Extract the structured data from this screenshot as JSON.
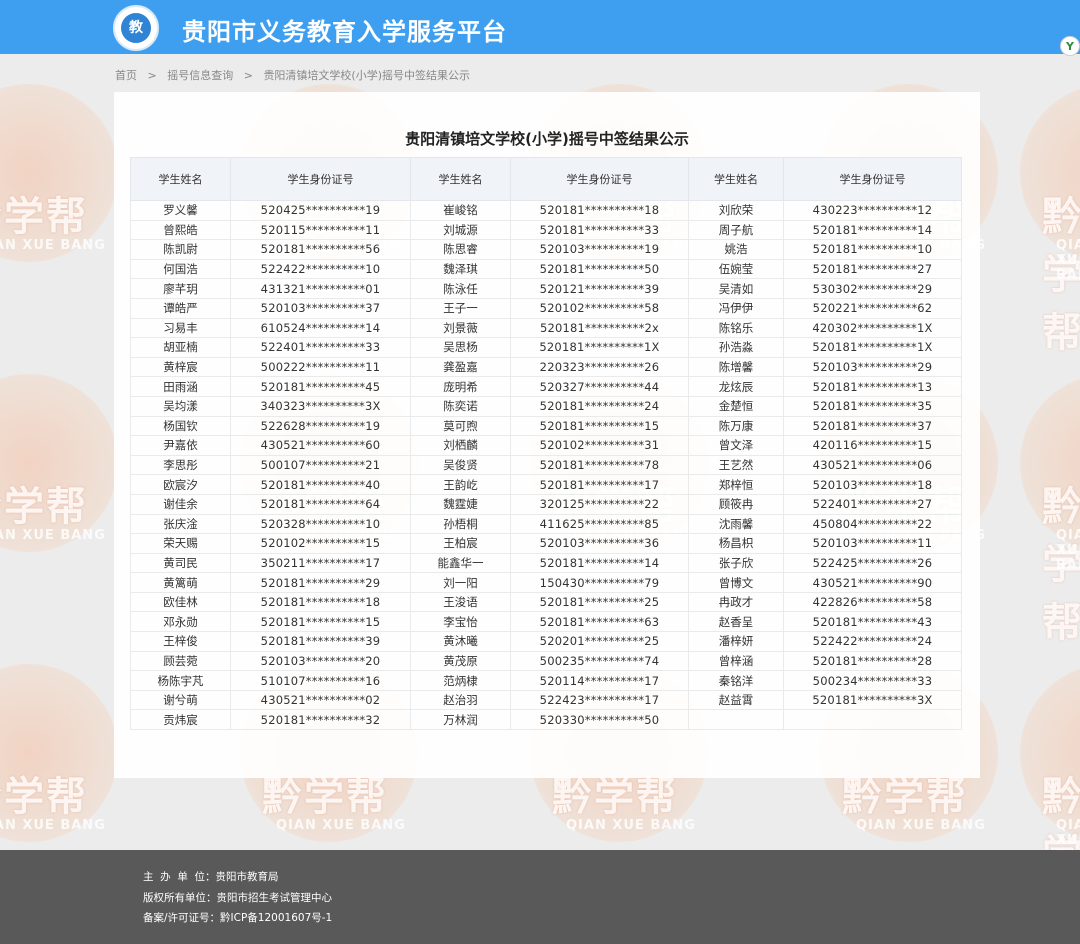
{
  "header": {
    "logo_text": "教",
    "site_title": "贵阳市义务教育入学服务平台",
    "corner_badge": "Y"
  },
  "breadcrumb": {
    "items": [
      "首页",
      "摇号信息查询",
      "贵阳清镇培文学校(小学)摇号中签结果公示"
    ],
    "separator": ">"
  },
  "watermark": {
    "brand_cn": "黔学帮",
    "brand_en": "QIAN XUE BANG"
  },
  "result_table": {
    "title": "贵阳清镇培文学校(小学)摇号中签结果公示",
    "headers": {
      "name": "学生姓名",
      "id": "学生身份证号"
    },
    "columns": [
      [
        {
          "name": "罗义馨",
          "id": "520425**********19"
        },
        {
          "name": "曾熙皓",
          "id": "520115**********11"
        },
        {
          "name": "陈凯尉",
          "id": "520181**********56"
        },
        {
          "name": "何国浩",
          "id": "522422**********10"
        },
        {
          "name": "廖芊玥",
          "id": "431321**********01"
        },
        {
          "name": "谭皓严",
          "id": "520103**********37"
        },
        {
          "name": "习易丰",
          "id": "610524**********14"
        },
        {
          "name": "胡亚楠",
          "id": "522401**********33"
        },
        {
          "name": "黄梓宸",
          "id": "500222**********11"
        },
        {
          "name": "田雨涵",
          "id": "520181**********45"
        },
        {
          "name": "吴均漾",
          "id": "340323**********3X"
        },
        {
          "name": "杨国钦",
          "id": "522628**********19"
        },
        {
          "name": "尹嘉依",
          "id": "430521**********60"
        },
        {
          "name": "李思彤",
          "id": "500107**********21"
        },
        {
          "name": "欧宸汐",
          "id": "520181**********40"
        },
        {
          "name": "谢佳余",
          "id": "520181**********64"
        },
        {
          "name": "张庆淦",
          "id": "520328**********10"
        },
        {
          "name": "荣天赐",
          "id": "520102**********15"
        },
        {
          "name": "黄司民",
          "id": "350211**********17"
        },
        {
          "name": "黄篱萌",
          "id": "520181**********29"
        },
        {
          "name": "欧佳林",
          "id": "520181**********18"
        },
        {
          "name": "邓永勋",
          "id": "520181**********15"
        },
        {
          "name": "王梓俊",
          "id": "520181**********39"
        },
        {
          "name": "顾芸菀",
          "id": "520103**********20"
        },
        {
          "name": "杨陈宇芃",
          "id": "510107**********16"
        },
        {
          "name": "谢兮萌",
          "id": "430521**********02"
        },
        {
          "name": "贡炜宸",
          "id": "520181**********32"
        }
      ],
      [
        {
          "name": "崔峻铭",
          "id": "520181**********18"
        },
        {
          "name": "刘城源",
          "id": "520181**********33"
        },
        {
          "name": "陈思睿",
          "id": "520103**********19"
        },
        {
          "name": "魏泽琪",
          "id": "520181**********50"
        },
        {
          "name": "陈泳任",
          "id": "520121**********39"
        },
        {
          "name": "王子一",
          "id": "520102**********58"
        },
        {
          "name": "刘景薇",
          "id": "520181**********2x"
        },
        {
          "name": "吴思杨",
          "id": "520181**********1X"
        },
        {
          "name": "龚盈嘉",
          "id": "220323**********26"
        },
        {
          "name": "庞明希",
          "id": "520327**********44"
        },
        {
          "name": "陈奕诺",
          "id": "520181**********24"
        },
        {
          "name": "莫可煦",
          "id": "520181**********15"
        },
        {
          "name": "刘栖麟",
          "id": "520102**********31"
        },
        {
          "name": "吴俊贤",
          "id": "520181**********78"
        },
        {
          "name": "王韵屹",
          "id": "520181**********17"
        },
        {
          "name": "魏霆婕",
          "id": "320125**********22"
        },
        {
          "name": "孙梧桐",
          "id": "411625**********85"
        },
        {
          "name": "王柏宸",
          "id": "520103**********36"
        },
        {
          "name": "能鑫华一",
          "id": "520181**********14"
        },
        {
          "name": "刘一阳",
          "id": "150430**********79"
        },
        {
          "name": "王浚语",
          "id": "520181**********25"
        },
        {
          "name": "李宝怡",
          "id": "520181**********63"
        },
        {
          "name": "黄沐曦",
          "id": "520201**********25"
        },
        {
          "name": "黄茂原",
          "id": "500235**********74"
        },
        {
          "name": "范炳棣",
          "id": "520114**********17"
        },
        {
          "name": "赵治羽",
          "id": "522423**********17"
        },
        {
          "name": "万林润",
          "id": "520330**********50"
        }
      ],
      [
        {
          "name": "刘欣荣",
          "id": "430223**********12"
        },
        {
          "name": "周子航",
          "id": "520181**********14"
        },
        {
          "name": "姚浩",
          "id": "520181**********10"
        },
        {
          "name": "伍婉莹",
          "id": "520181**********27"
        },
        {
          "name": "吴清如",
          "id": "530302**********29"
        },
        {
          "name": "冯伊伊",
          "id": "520221**********62"
        },
        {
          "name": "陈铭乐",
          "id": "420302**********1X"
        },
        {
          "name": "孙浩淼",
          "id": "520181**********1X"
        },
        {
          "name": "陈增馨",
          "id": "520103**********29"
        },
        {
          "name": "龙炫辰",
          "id": "520181**********13"
        },
        {
          "name": "金楚恒",
          "id": "520181**********35"
        },
        {
          "name": "陈万康",
          "id": "520181**********37"
        },
        {
          "name": "曾文泽",
          "id": "420116**********15"
        },
        {
          "name": "王艺然",
          "id": "430521**********06"
        },
        {
          "name": "郑梓恒",
          "id": "520103**********18"
        },
        {
          "name": "顾筱冉",
          "id": "522401**********27"
        },
        {
          "name": "沈雨馨",
          "id": "450804**********22"
        },
        {
          "name": "杨昌枳",
          "id": "520103**********11"
        },
        {
          "name": "张子欣",
          "id": "522425**********26"
        },
        {
          "name": "曾博文",
          "id": "430521**********90"
        },
        {
          "name": "冉政才",
          "id": "422826**********58"
        },
        {
          "name": "赵香呈",
          "id": "520181**********43"
        },
        {
          "name": "潘梓妍",
          "id": "522422**********24"
        },
        {
          "name": "曾梓涵",
          "id": "520181**********28"
        },
        {
          "name": "秦铭洋",
          "id": "500234**********33"
        },
        {
          "name": "赵益霄",
          "id": "520181**********3X"
        }
      ]
    ]
  },
  "footer": {
    "host_label": "主  办  单  位：",
    "host_value": "贵阳市教育局",
    "copyright_label": "版权所有单位：",
    "copyright_value": "贵阳市招生考试管理中心",
    "icp_label": "备案/许可证号：",
    "icp_value": "黔ICP备12001607号-1"
  },
  "colors": {
    "header_bg": "#3e9ff0",
    "footer_bg": "#595959",
    "table_header_bg": "#f0f3f8"
  }
}
